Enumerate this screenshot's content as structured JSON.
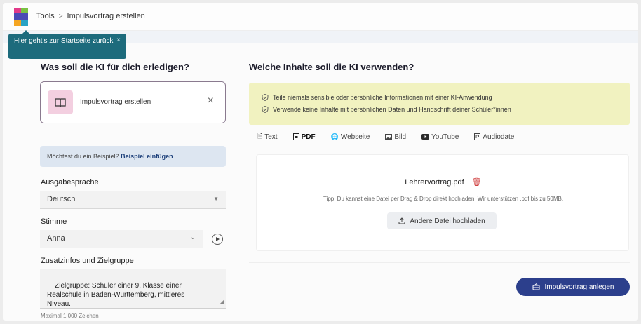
{
  "header": {
    "breadcrumb": [
      {
        "label": "Tools"
      },
      {
        "label": "Impulsvortrag erstellen"
      }
    ],
    "separator": ">"
  },
  "tooltip": {
    "text": "Hier geht's zur Startseite zurück",
    "close": "×"
  },
  "left": {
    "heading": "Was soll die KI für dich erledigen?",
    "task": {
      "label": "Impulsvortrag erstellen",
      "icon": "book-icon",
      "close": "×"
    },
    "example": {
      "prompt": "Möchtest du ein Beispiel?",
      "link": "Beispiel einfügen"
    },
    "language": {
      "label": "Ausgabesprache",
      "value": "Deutsch"
    },
    "voice": {
      "label": "Stimme",
      "value": "Anna"
    },
    "extra": {
      "label": "Zusatzinfos und Zielgruppe",
      "value": "Zielgruppe: Schüler einer 9. Klasse einer\nRealschule in Baden-Württemberg, mittleres\nNiveau.",
      "hint": "Maximal 1.000 Zeichen"
    }
  },
  "right": {
    "heading": "Welche Inhalte soll die KI verwenden?",
    "warnings": [
      "Teile niemals sensible oder persönliche Informationen mit einer KI-Anwendung",
      "Verwende keine Inhalte mit persönlichen Daten und Handschrift deiner Schüler*innen"
    ],
    "tabs": [
      {
        "label": "Text",
        "icon": "text-file-icon",
        "active": false
      },
      {
        "label": "PDF",
        "icon": "pdf-file-icon",
        "active": true
      },
      {
        "label": "Webseite",
        "icon": "globe-icon",
        "active": false
      },
      {
        "label": "Bild",
        "icon": "image-icon",
        "active": false
      },
      {
        "label": "YouTube",
        "icon": "youtube-icon",
        "active": false
      },
      {
        "label": "Audiodatei",
        "icon": "audio-file-icon",
        "active": false
      }
    ],
    "upload": {
      "filename": "Lehrervortrag.pdf",
      "tip": "Tipp: Du kannst eine Datei per Drag & Drop direkt hochladen. Wir unterstützen .pdf bis zu 50MB.",
      "button": "Andere Datei hochladen"
    },
    "submit": "Impulsvortrag anlegen"
  },
  "colors": {
    "accent": "#2c3f8c",
    "tooltip": "#1d6b7c",
    "warning_bg": "#f1f2c0",
    "task_icon_bg": "#f3cfe0",
    "trash": "#d04040"
  }
}
